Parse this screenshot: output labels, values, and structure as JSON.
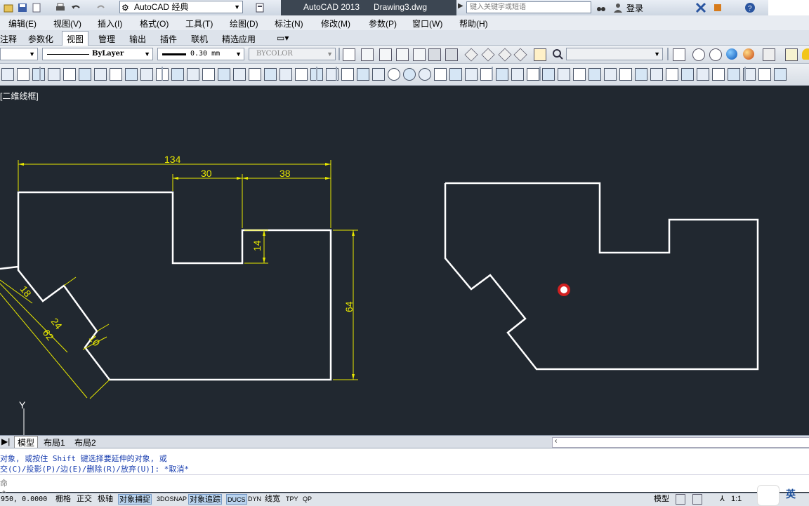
{
  "title_bar": {
    "workspace": "AutoCAD 经典",
    "app_name": "AutoCAD 2013",
    "document": "Drawing3.dwg",
    "search_placeholder": "键入关键字或短语",
    "login": "登录"
  },
  "menu": [
    "编辑(E)",
    "视图(V)",
    "插入(I)",
    "格式(O)",
    "工具(T)",
    "绘图(D)",
    "标注(N)",
    "修改(M)",
    "参数(P)",
    "窗口(W)",
    "帮助(H)"
  ],
  "ribbon_tabs": [
    "注释",
    "参数化",
    "视图",
    "管理",
    "输出",
    "插件",
    "联机",
    "精选应用"
  ],
  "ribbon_active": "视图",
  "properties": {
    "linetype": "ByLayer",
    "lineweight": "0.30 mm",
    "plotstyle": "BYCOLOR"
  },
  "viewport_label": "[二维线框]",
  "dimensions": {
    "overall_width": "134",
    "notch_width": "30",
    "right_step_width": "38",
    "notch_depth": "14",
    "right_height": "64",
    "tab_length": "18",
    "tab_width": "24",
    "slant_length": "62",
    "tab_depth": "10"
  },
  "ucs_axis": "Y",
  "layout_tabs": [
    "模型",
    "布局1",
    "布局2"
  ],
  "command_lines": [
    "对象, 或按住 Shift 键选择要延伸的对象, 或",
    "交(C)/投影(P)/边(E)/删除(R)/放弃(U)]: *取消*"
  ],
  "command_prompt": "命令",
  "status": {
    "coords": "950, 0.0000",
    "buttons": [
      "栅格",
      "正交",
      "极轴",
      "对象捕捉",
      "3DOSNAP",
      "对象追踪",
      "DUCS",
      "DYN",
      "线宽",
      "TPY",
      "QP"
    ],
    "buttons_on": [
      "对象捕捉",
      "对象追踪",
      "DUCS"
    ],
    "model": "模型",
    "scale": "1:1",
    "ime": "英"
  },
  "colors": {
    "canvas": "#212830",
    "geometry": "#ffffff",
    "dimension": "#e8e800",
    "cursor": "#d02020"
  }
}
